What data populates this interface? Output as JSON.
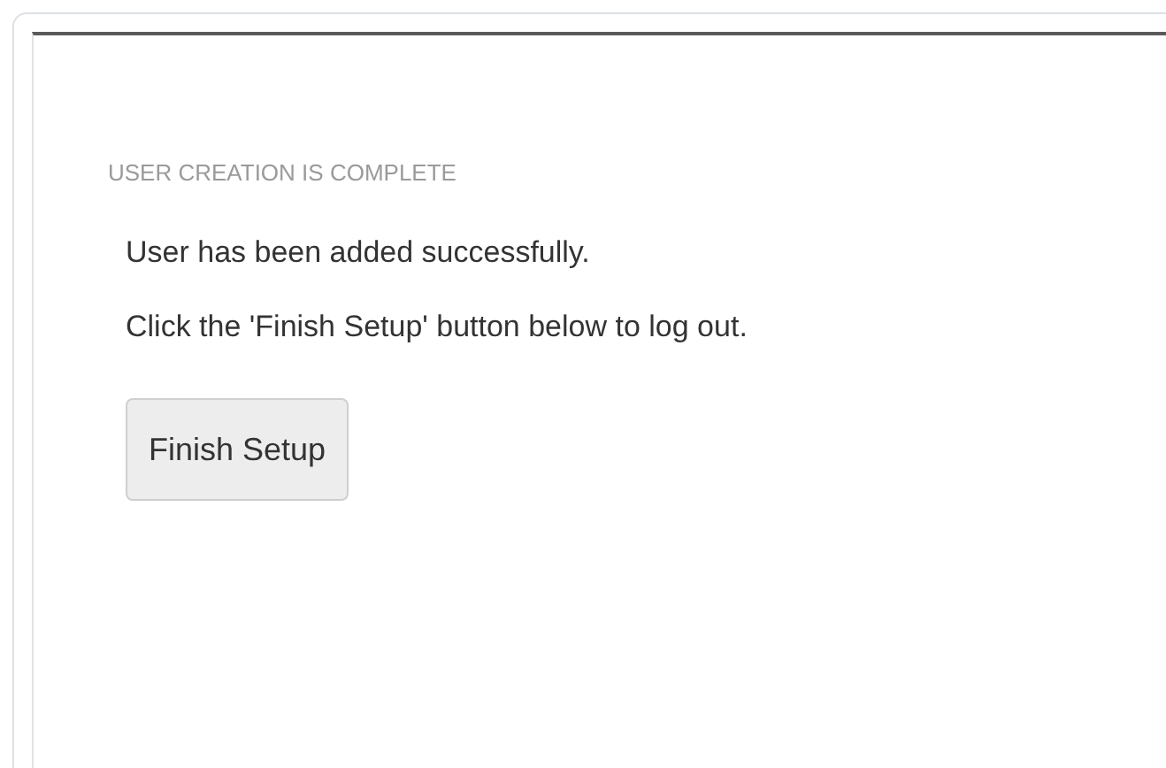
{
  "panel": {
    "heading": "USER CREATION IS COMPLETE",
    "messages": [
      "User has been added successfully.",
      "Click the 'Finish Setup' button below to log out."
    ],
    "button": {
      "label": "Finish Setup"
    }
  }
}
